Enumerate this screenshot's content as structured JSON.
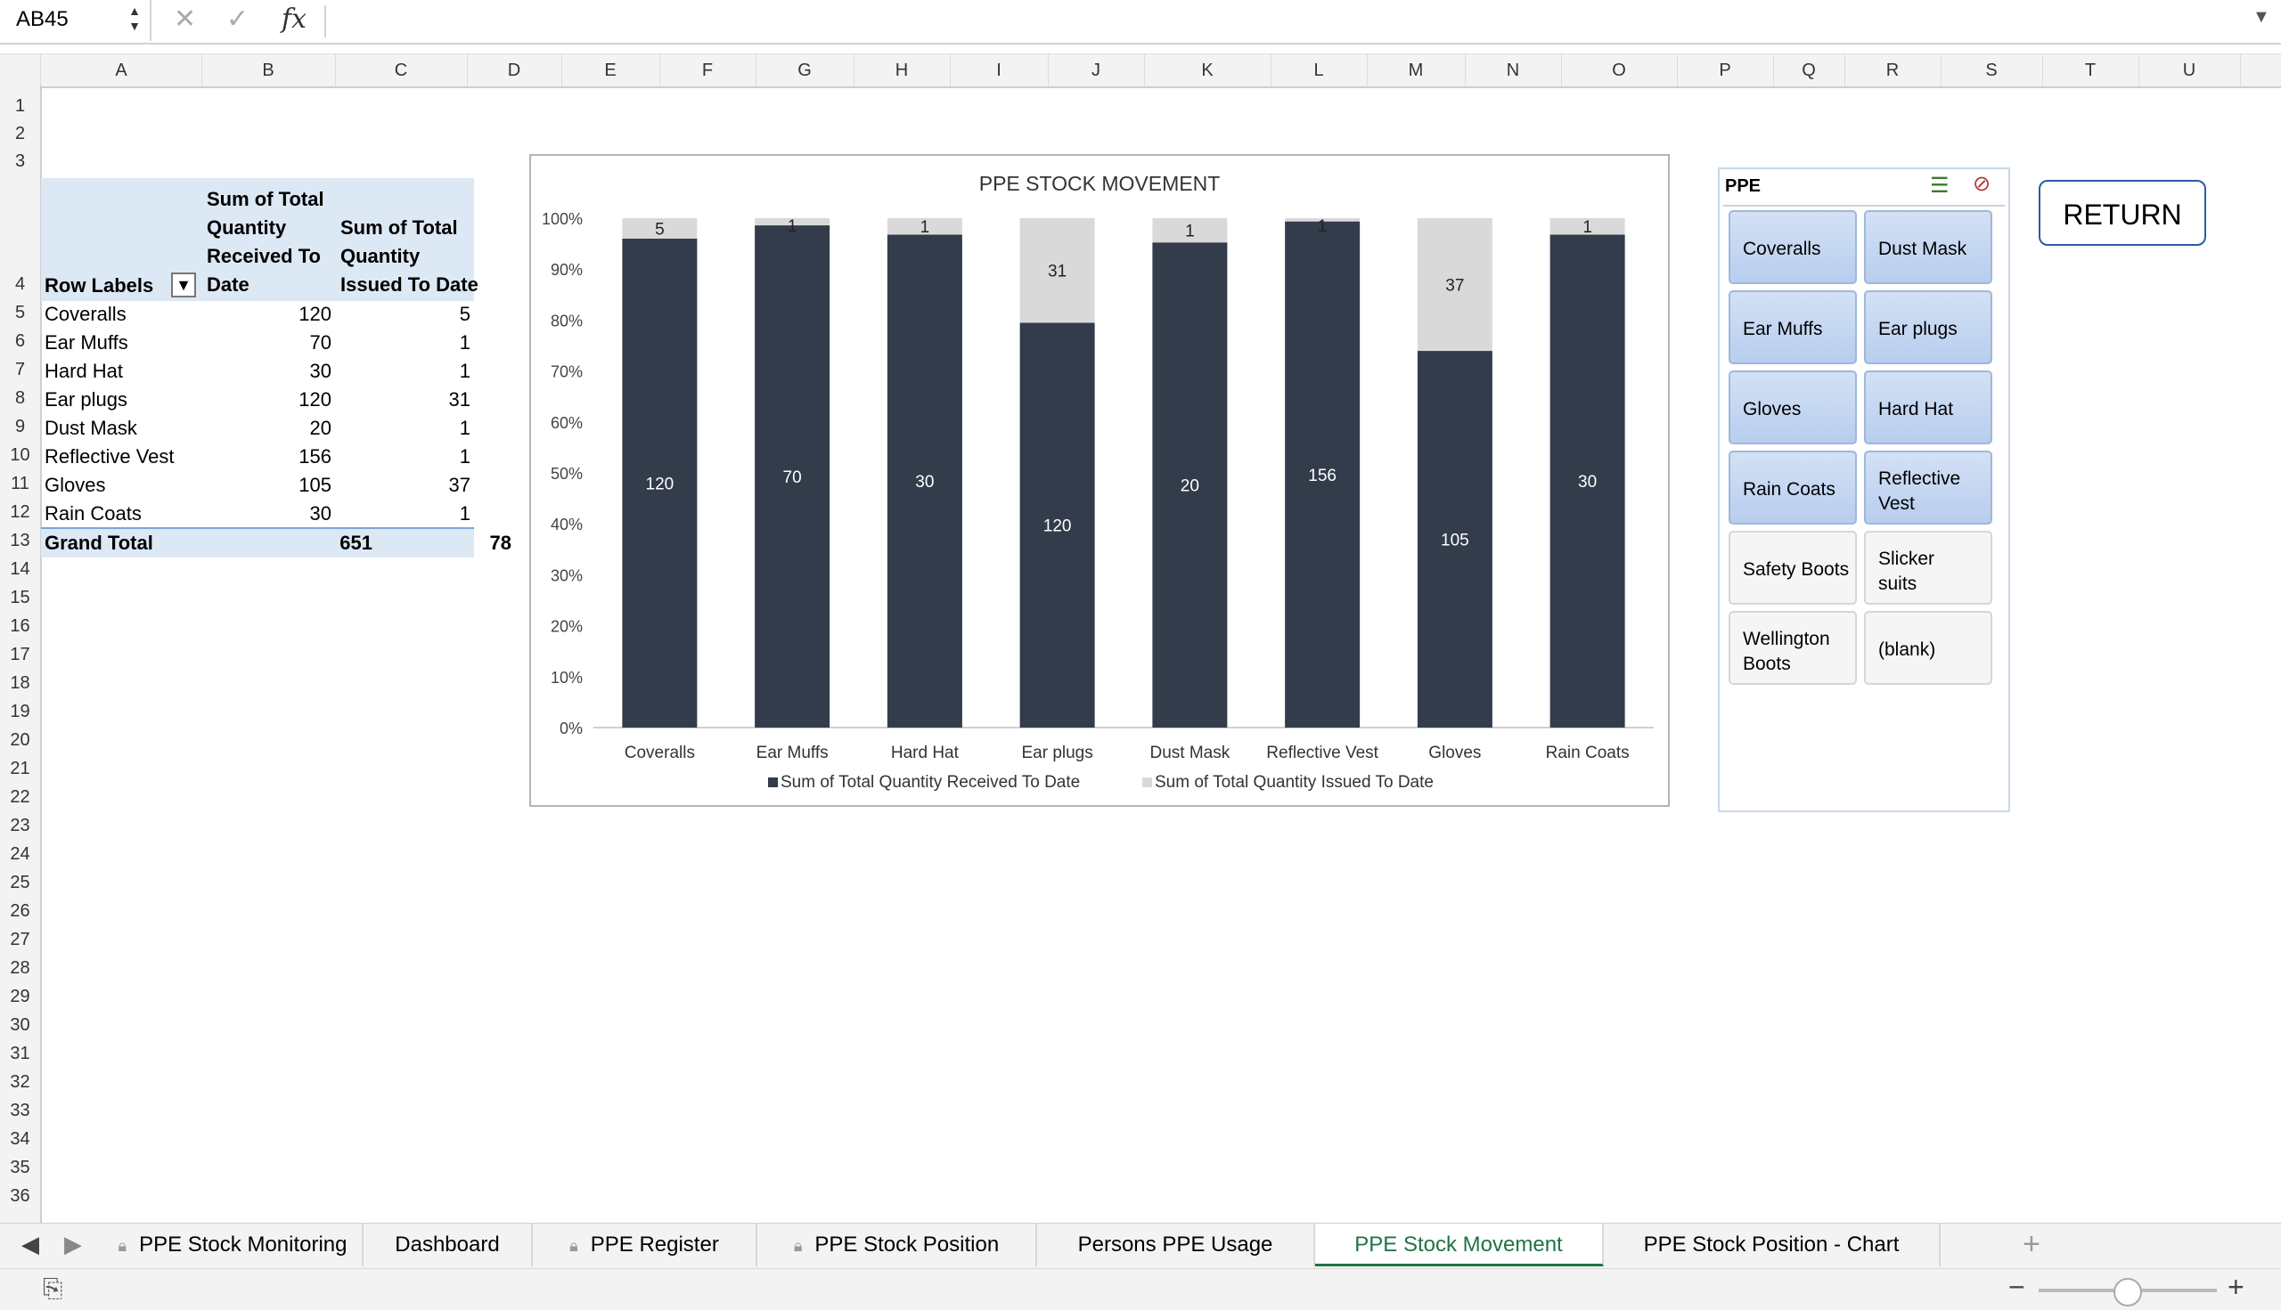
{
  "formula_bar": {
    "name_box": "AB45",
    "fx_label": "fx",
    "formula": ""
  },
  "columns": [
    "A",
    "B",
    "C",
    "D",
    "E",
    "F",
    "G",
    "H",
    "I",
    "J",
    "K",
    "L",
    "M",
    "N",
    "O",
    "P",
    "Q",
    "R",
    "S",
    "T",
    "U"
  ],
  "rows": [
    "1",
    "2",
    "3",
    "4",
    "5",
    "6",
    "7",
    "8",
    "9",
    "10",
    "11",
    "12",
    "13",
    "14",
    "15",
    "16",
    "17",
    "18",
    "19",
    "20",
    "21",
    "22",
    "23",
    "24",
    "25",
    "26",
    "27",
    "28",
    "29",
    "30",
    "31",
    "32",
    "33",
    "34",
    "35",
    "36"
  ],
  "pivot": {
    "header_a": "Row Labels",
    "header_b": [
      "Sum of Total",
      "Quantity",
      "Received To",
      "Date"
    ],
    "header_c": [
      "Sum of Total",
      "Quantity",
      "Issued To Date"
    ],
    "rows": [
      {
        "label": "Coveralls",
        "received": "120",
        "issued": "5"
      },
      {
        "label": "Ear Muffs",
        "received": "70",
        "issued": "1"
      },
      {
        "label": "Hard Hat",
        "received": "30",
        "issued": "1"
      },
      {
        "label": "Ear plugs",
        "received": "120",
        "issued": "31"
      },
      {
        "label": "Dust Mask",
        "received": "20",
        "issued": "1"
      },
      {
        "label": "Reflective Vest",
        "received": "156",
        "issued": "1"
      },
      {
        "label": "Gloves",
        "received": "105",
        "issued": "37"
      },
      {
        "label": "Rain Coats",
        "received": "30",
        "issued": "1"
      }
    ],
    "total": {
      "label": "Grand Total",
      "received": "651",
      "issued": "78"
    }
  },
  "chart_data": {
    "type": "bar",
    "stacked": "percent",
    "title": "PPE STOCK MOVEMENT",
    "categories": [
      "Coveralls",
      "Ear Muffs",
      "Hard Hat",
      "Ear plugs",
      "Dust Mask",
      "Reflective Vest",
      "Gloves",
      "Rain Coats"
    ],
    "series": [
      {
        "name": "Sum of Total Quantity Received To Date",
        "values": [
          120,
          70,
          30,
          120,
          20,
          156,
          105,
          30
        ],
        "color": "#333c4b"
      },
      {
        "name": "Sum of Total Quantity Issued To Date",
        "values": [
          5,
          1,
          1,
          31,
          1,
          1,
          37,
          1
        ],
        "color": "#d9d9d9"
      }
    ],
    "y_ticks": [
      "0%",
      "10%",
      "20%",
      "30%",
      "40%",
      "50%",
      "60%",
      "70%",
      "80%",
      "90%",
      "100%"
    ],
    "ylim": [
      0,
      100
    ],
    "legend_position": "bottom",
    "grid": false
  },
  "slicer": {
    "title": "PPE",
    "items": [
      {
        "label": "Coveralls",
        "selected": true
      },
      {
        "label": "Dust Mask",
        "selected": true
      },
      {
        "label": "Ear Muffs",
        "selected": true
      },
      {
        "label": "Ear plugs",
        "selected": true
      },
      {
        "label": "Gloves",
        "selected": true
      },
      {
        "label": "Hard Hat",
        "selected": true
      },
      {
        "label": "Rain Coats",
        "selected": true
      },
      {
        "label": "Reflective Vest",
        "selected": true
      },
      {
        "label": "Safety Boots",
        "selected": false
      },
      {
        "label": "Slicker suits",
        "selected": false
      },
      {
        "label": "Wellington Boots",
        "selected": false
      },
      {
        "label": "(blank)",
        "selected": false
      }
    ]
  },
  "return_label": "RETURN",
  "tabs": [
    {
      "label": "PPE Stock Monitoring",
      "locked": true,
      "active": false
    },
    {
      "label": "Dashboard",
      "locked": false,
      "active": false
    },
    {
      "label": "PPE Register",
      "locked": true,
      "active": false
    },
    {
      "label": "PPE Stock Position",
      "locked": true,
      "active": false
    },
    {
      "label": "Persons PPE Usage",
      "locked": false,
      "active": false
    },
    {
      "label": "PPE Stock Movement",
      "locked": false,
      "active": true
    },
    {
      "label": "PPE Stock Position - Chart",
      "locked": false,
      "active": false
    }
  ],
  "add_sheet": "+"
}
